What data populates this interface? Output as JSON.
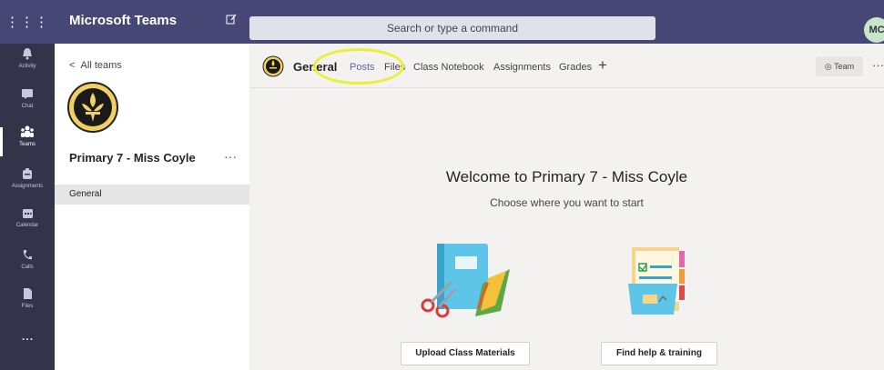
{
  "app": {
    "title": "Microsoft Teams",
    "waffle": "⋮⋮⋮",
    "compose_icon": "compose-icon"
  },
  "search": {
    "placeholder": "Search or type a command"
  },
  "user": {
    "initials": "MC"
  },
  "rail": {
    "items": [
      {
        "label": "Activity",
        "icon": "bell-icon",
        "glyph": "🔔"
      },
      {
        "label": "Chat",
        "icon": "chat-icon",
        "glyph": "▤"
      },
      {
        "label": "Teams",
        "icon": "teams-icon",
        "glyph": "⁂"
      },
      {
        "label": "Assignments",
        "icon": "assignments-icon",
        "glyph": "◘"
      },
      {
        "label": "Calendar",
        "icon": "calendar-icon",
        "glyph": "▦"
      },
      {
        "label": "Calls",
        "icon": "phone-icon",
        "glyph": "✆"
      },
      {
        "label": "Files",
        "icon": "file-icon",
        "glyph": "▮"
      }
    ],
    "active": "Teams",
    "more": "..."
  },
  "team_pane": {
    "back_label": "All teams",
    "team_name": "Primary 7 - Miss Coyle",
    "more": "···",
    "channels": [
      "General"
    ]
  },
  "channel_header": {
    "name": "General",
    "tabs": [
      "Posts",
      "Files",
      "Class Notebook",
      "Assignments",
      "Grades"
    ],
    "active_tab": "Posts",
    "add_tab": "+",
    "team_button": "◎ Team",
    "more": "···"
  },
  "main": {
    "welcome": "Welcome to Primary 7 - Miss Coyle",
    "subtitle": "Choose where you want to start",
    "cards": [
      {
        "label": "Upload Class Materials"
      },
      {
        "label": "Find help & training"
      }
    ]
  },
  "colors": {
    "topbar": "#464775",
    "rail": "#33344a",
    "accent": "#6264a7",
    "highlight": "#eaf032"
  }
}
